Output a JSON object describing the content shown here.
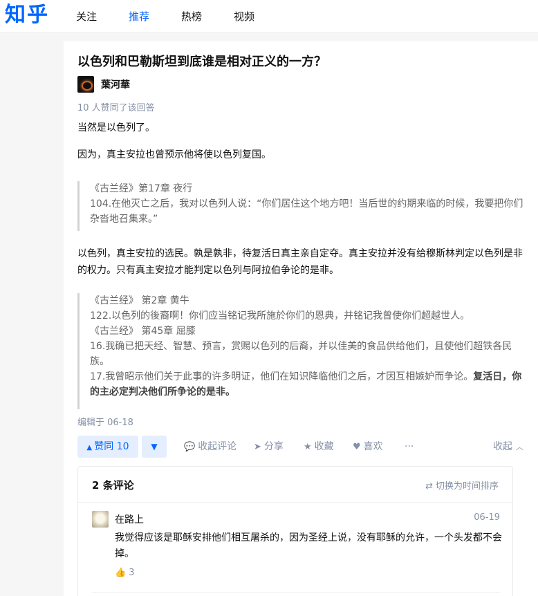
{
  "header": {
    "logo": "知乎",
    "nav": [
      "关注",
      "推荐",
      "热榜",
      "视频"
    ]
  },
  "question": {
    "title": "以色列和巴勒斯坦到底谁是相对正义的一方？"
  },
  "answer": {
    "author": "葉河華",
    "votes_line": "10 人赞同了该回答",
    "p1": "当然是以色列了。",
    "p2": "因为，真主安拉也曾预示他将使以色列复国。",
    "quote1": [
      "《古兰经》第17章 夜行",
      "104.在他灭亡之后，我对以色列人说：“你们居住这个地方吧！当后世的约期来临的时候，我要把你们杂沓地召集来。”"
    ],
    "p3": "以色列，真主安拉的选民。孰是孰非，待复活日真主亲自定夺。真主安拉并没有给穆斯林判定以色列是非的权力。只有真主安拉才能判定以色列与阿拉伯争论的是非。",
    "quote2": {
      "l1": "《古兰经》 第2章 黄牛",
      "l2": "122.以色列的後裔啊！你们应当铭记我所施於你们的恩典，并铭记我曾使你们超越世人。",
      "l3": "《古兰经》 第45章 屈膝",
      "l4": "16.我确已把天经、智慧、预言，赏赐以色列的后裔，并以佳美的食品供给他们，且使他们超铁各民族。",
      "l5a": "17.我曾昭示他们关于此事的许多明证，他们在知识降临他们之后，才因互相嫉妒而争论。",
      "l5b": "复活日，你的主必定判决他们所争论的是非。"
    },
    "edited": "编辑于 06-18"
  },
  "actions": {
    "vote_up": "赞同 10",
    "vote_down": "▼",
    "collapse_comments": "收起评论",
    "share": "分享",
    "favorite": "收藏",
    "like": "喜欢",
    "more": "···",
    "collapse": "收起"
  },
  "comments": {
    "count": "2 条评论",
    "sort": "切换为时间排序",
    "items": [
      {
        "name": "在路上",
        "date": "06-19",
        "text": "我觉得应该是耶稣安排他们相互屠杀的，因为圣经上说，没有耶稣的允许，一个头发都不会掉。",
        "likes": "3"
      }
    ]
  },
  "colors": {
    "brand": "#0066ff",
    "muted": "#8590a6"
  }
}
